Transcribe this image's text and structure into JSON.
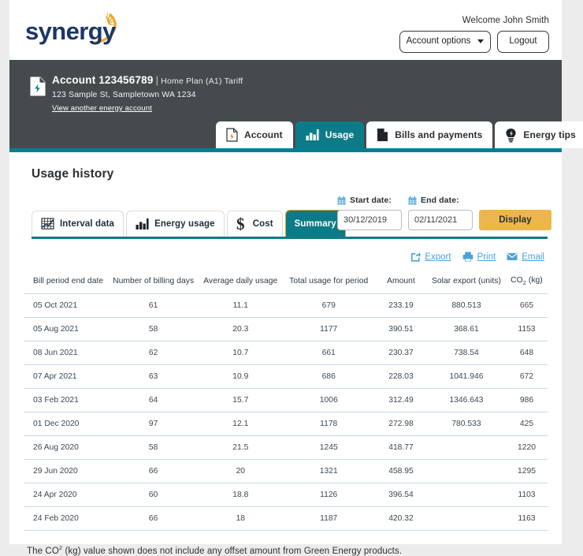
{
  "brand": {
    "logo_text": "synergy",
    "logo_color": "#1c3664",
    "logo_accent": "#f0a62c",
    "teal": "#0c7b87",
    "dark": "#454b4d",
    "gold": "#edb64b",
    "link_blue": "#4ba3d6"
  },
  "header": {
    "welcome": "Welcome John Smith",
    "account_options_label": "Account options",
    "logout_label": "Logout"
  },
  "account": {
    "label": "Account",
    "number": "123456789",
    "separator": "|",
    "tariff": "Home Plan (A1) Tariff",
    "address": "123 Sample St, Sampletown WA 1234",
    "switch_link": "View another energy account"
  },
  "nav_tabs": [
    {
      "label": "Account",
      "icon": "document-bolt-icon",
      "active": false
    },
    {
      "label": "Usage",
      "icon": "bar-chart-icon",
      "active": true
    },
    {
      "label": "Bills and payments",
      "icon": "document-icon",
      "active": false
    },
    {
      "label": "Energy tips",
      "icon": "lightbulb-icon",
      "active": false
    }
  ],
  "page": {
    "title": "Usage history"
  },
  "sub_tabs": [
    {
      "label": "Interval data",
      "icon": "grid-chart-icon",
      "active": false
    },
    {
      "label": "Energy usage",
      "icon": "bar-chart-icon",
      "active": false
    },
    {
      "label": "Cost",
      "icon": "dollar-icon",
      "active": false
    },
    {
      "label": "Summary",
      "icon": "",
      "active": true
    }
  ],
  "date_controls": {
    "start_label": "Start date:",
    "end_label": "End date:",
    "start_value": "30/12/2019",
    "end_value": "02/11/2021",
    "calendar_icon": "calendar-icon",
    "display_label": "Display"
  },
  "actions": [
    {
      "label": "Export",
      "icon": "export-icon"
    },
    {
      "label": "Print",
      "icon": "printer-icon"
    },
    {
      "label": "Email",
      "icon": "envelope-icon"
    }
  ],
  "table": {
    "columns": [
      "Bill period end date",
      "Number of billing days",
      "Average daily usage",
      "Total usage for period",
      "Amount",
      "Solar export (units)",
      "CO2 (kg)"
    ],
    "co2_column": {
      "prefix": "CO",
      "sub": "2",
      "suffix": " (kg)"
    },
    "rows": [
      {
        "date": "05 Oct 2021",
        "days": "61",
        "avg_daily": "11.1",
        "total": "679",
        "amount": "233.19",
        "solar": "880.513",
        "co2": "665"
      },
      {
        "date": "05 Aug 2021",
        "days": "58",
        "avg_daily": "20.3",
        "total": "1177",
        "amount": "390.51",
        "solar": "368.61",
        "co2": "1153"
      },
      {
        "date": "08 Jun 2021",
        "days": "62",
        "avg_daily": "10.7",
        "total": "661",
        "amount": "230.37",
        "solar": "738.54",
        "co2": "648"
      },
      {
        "date": "07 Apr 2021",
        "days": "63",
        "avg_daily": "10.9",
        "total": "686",
        "amount": "228.03",
        "solar": "1041.946",
        "co2": "672"
      },
      {
        "date": "03 Feb 2021",
        "days": "64",
        "avg_daily": "15.7",
        "total": "1006",
        "amount": "312.49",
        "solar": "1346.643",
        "co2": "986"
      },
      {
        "date": "01 Dec 2020",
        "days": "97",
        "avg_daily": "12.1",
        "total": "1178",
        "amount": "272.98",
        "solar": "780.533",
        "co2": "425"
      },
      {
        "date": "26 Aug 2020",
        "days": "58",
        "avg_daily": "21.5",
        "total": "1245",
        "amount": "418.77",
        "solar": "",
        "co2": "1220"
      },
      {
        "date": "29 Jun 2020",
        "days": "66",
        "avg_daily": "20",
        "total": "1321",
        "amount": "458.95",
        "solar": "",
        "co2": "1295"
      },
      {
        "date": "24 Apr 2020",
        "days": "60",
        "avg_daily": "18.8",
        "total": "1126",
        "amount": "396.54",
        "solar": "",
        "co2": "1103"
      },
      {
        "date": "24 Feb 2020",
        "days": "66",
        "avg_daily": "18",
        "total": "1187",
        "amount": "420.32",
        "solar": "",
        "co2": "1163"
      }
    ]
  },
  "footnote": {
    "prefix": "The CO",
    "sup": "2",
    "rest": " (kg) value shown does not include any offset amount from Green Energy products."
  }
}
